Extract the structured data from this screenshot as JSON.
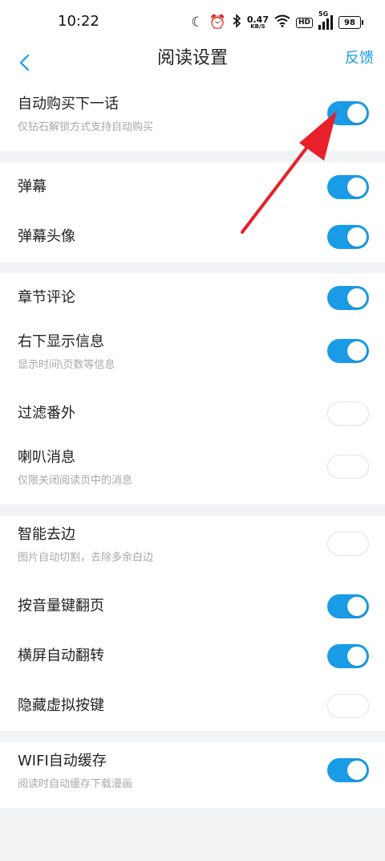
{
  "status_bar": {
    "time": "10:22",
    "net_speed": "0.47",
    "net_unit": "KB/S",
    "hd": "HD",
    "signal": "5G",
    "battery": "98"
  },
  "header": {
    "title": "阅读设置",
    "feedback": "反馈"
  },
  "colors": {
    "accent": "#1a9be6",
    "arrow": "#e8202a"
  },
  "groups": [
    {
      "items": [
        {
          "id": "auto-buy-next",
          "label": "自动购买下一话",
          "sub": "仅钻石解锁方式支持自动购买",
          "on": true
        }
      ]
    },
    {
      "items": [
        {
          "id": "danmaku",
          "label": "弹幕",
          "sub": "",
          "on": true
        },
        {
          "id": "danmaku-avatar",
          "label": "弹幕头像",
          "sub": "",
          "on": true
        }
      ]
    },
    {
      "items": [
        {
          "id": "chapter-comments",
          "label": "章节评论",
          "sub": "",
          "on": true
        },
        {
          "id": "bottom-right-info",
          "label": "右下显示信息",
          "sub": "显示时间\\页数等信息",
          "on": true
        },
        {
          "id": "filter-extras",
          "label": "过滤番外",
          "sub": "",
          "on": false
        },
        {
          "id": "speaker-messages",
          "label": "喇叭消息",
          "sub": "仅限关闭阅读页中的消息",
          "on": false
        }
      ]
    },
    {
      "items": [
        {
          "id": "smart-crop",
          "label": "智能去边",
          "sub": "图片自动切割，去除多余白边",
          "on": false
        },
        {
          "id": "volume-key-turn",
          "label": "按音量键翻页",
          "sub": "",
          "on": true
        },
        {
          "id": "landscape-auto-rotate",
          "label": "横屏自动翻转",
          "sub": "",
          "on": true
        },
        {
          "id": "hide-virtual-keys",
          "label": "隐藏虚拟按键",
          "sub": "",
          "on": false
        }
      ]
    },
    {
      "items": [
        {
          "id": "wifi-auto-cache",
          "label": "WIFI自动缓存",
          "sub": "阅读时自动缓存下载漫画",
          "on": true
        }
      ]
    }
  ]
}
